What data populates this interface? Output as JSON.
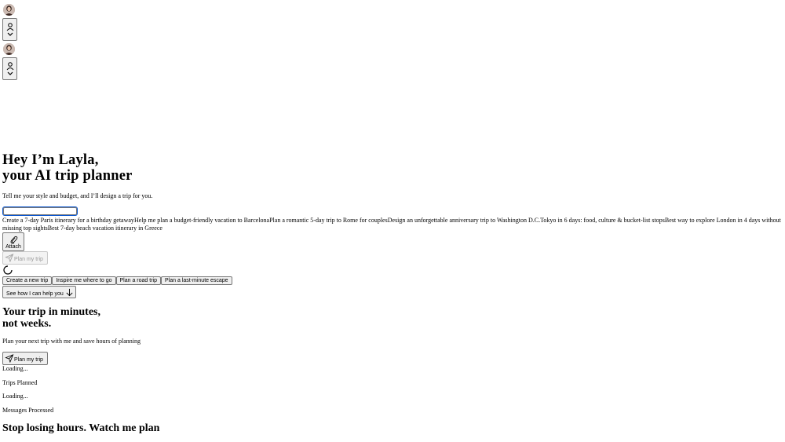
{
  "hero": {
    "line1": "Hey I’m Layla,",
    "line2": "your AI trip planner",
    "subtitle": "Tell me your style and budget, and I’ll design a trip for you."
  },
  "chat": {
    "input_value": "",
    "attach_label": "Attach",
    "submit_label": "Plan my trip"
  },
  "suggestions": [
    "Create a 7-day Paris itinerary for a birthday getaway",
    "Help me plan a budget-friendly vacation to Barcelona",
    "Plan a romantic 5-day trip to Rome for couples",
    "Design an unforgettable anniversary trip to Washington D.C.",
    "Tokyo in 6 days: food, culture & bucket-list stops",
    "Best way to explore London in 4 days without missing top sights",
    "Best 7-day beach vacation itinerary in Greece"
  ],
  "chips": [
    "Create a new trip",
    "Inspire me where to go",
    "Plan a road trip",
    "Plan a last-minute escape"
  ],
  "see_how_label": "See how I can help you",
  "section2": {
    "line1": "Your trip in minutes,",
    "line2": "not weeks.",
    "subtitle": "Plan your next trip with me and save hours of planning",
    "cta_label": "Plan my trip"
  },
  "stats": [
    {
      "value": "Loading...",
      "label": "Trips Planned"
    },
    {
      "value": "Loading...",
      "label": "Messages Processed"
    }
  ],
  "section3": {
    "title": "Stop losing hours. Watch me plan"
  },
  "icons": {
    "avatar": "layla-avatar",
    "user": "user-icon",
    "chevron": "chevron-down-icon",
    "attach": "paperclip-icon",
    "send": "send-icon",
    "spinner": "loading-spinner-icon",
    "arrow": "arrow-down-icon"
  }
}
